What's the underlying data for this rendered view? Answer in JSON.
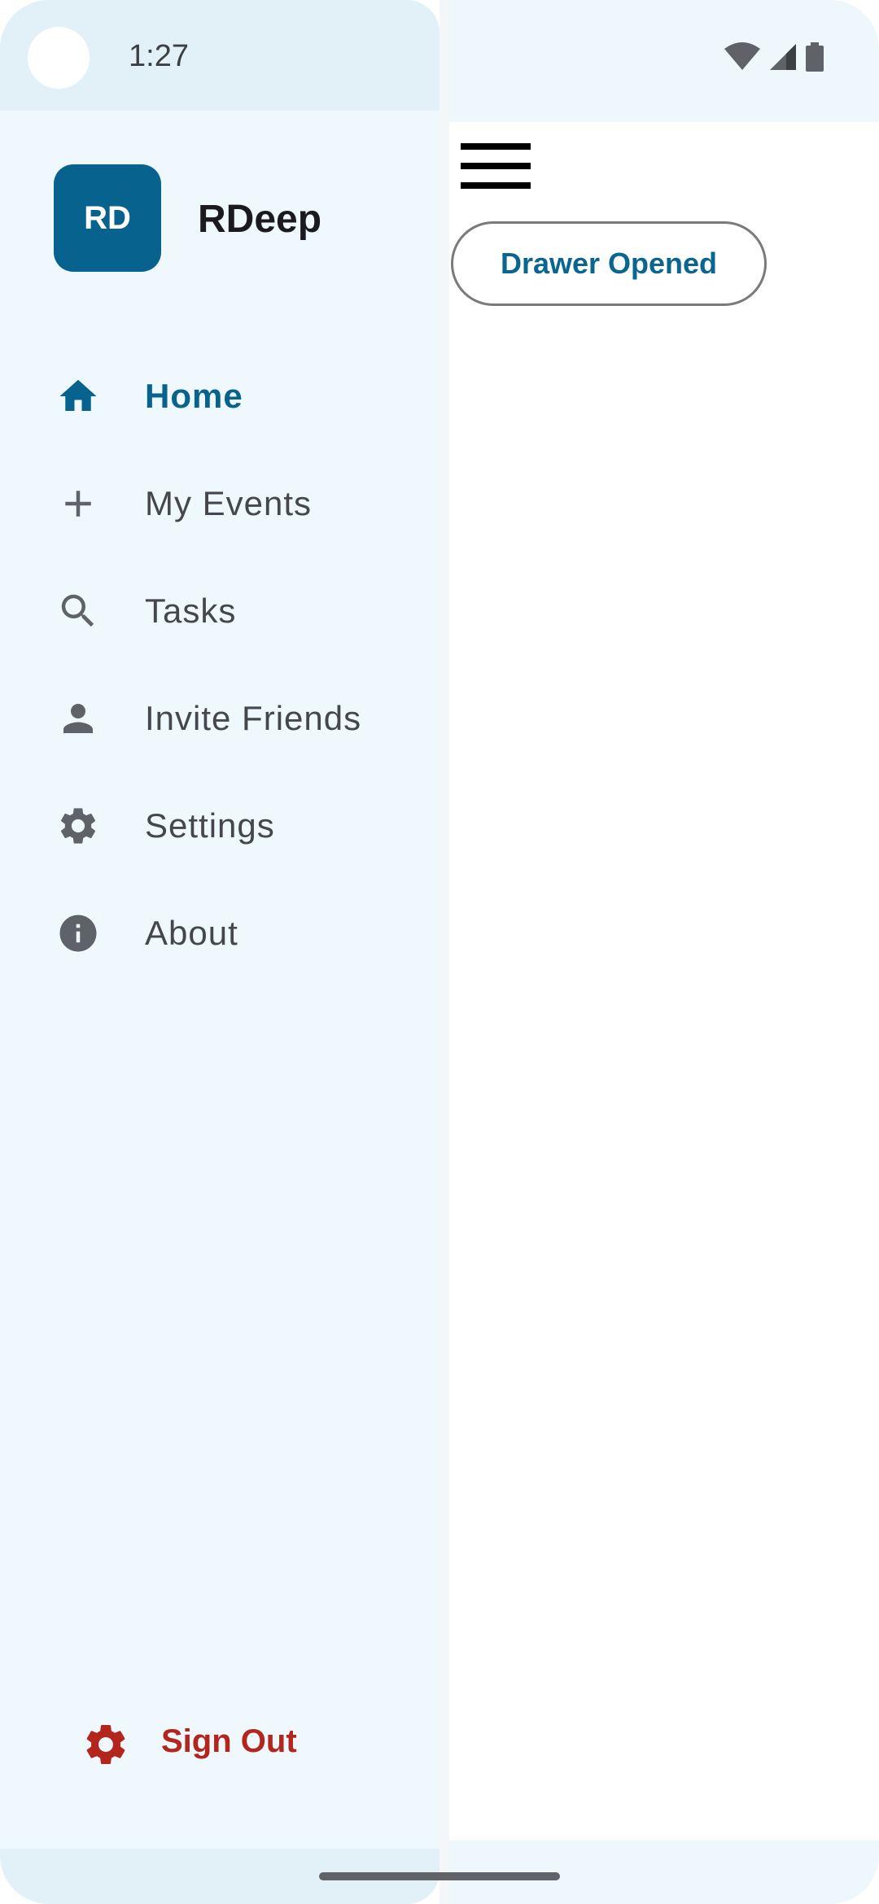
{
  "status_bar": {
    "time": "1:27",
    "icons": [
      "wifi-icon",
      "signal-icon",
      "battery-icon"
    ]
  },
  "drawer": {
    "avatar_initials": "RD",
    "username": "RDeep",
    "items": [
      {
        "label": "Home",
        "icon": "home-icon",
        "active": true
      },
      {
        "label": "My Events",
        "icon": "plus-icon",
        "active": false
      },
      {
        "label": "Tasks",
        "icon": "search-icon",
        "active": false
      },
      {
        "label": "Invite Friends",
        "icon": "person-icon",
        "active": false
      },
      {
        "label": "Settings",
        "icon": "gear-icon",
        "active": false
      },
      {
        "label": "About",
        "icon": "info-icon",
        "active": false
      }
    ],
    "sign_out_label": "Sign Out"
  },
  "main": {
    "button_label": "Drawer Opened"
  },
  "colors": {
    "accent": "#07638e",
    "danger": "#b3261e",
    "drawer_bg": "#eef8fd",
    "text": "#45474b"
  }
}
